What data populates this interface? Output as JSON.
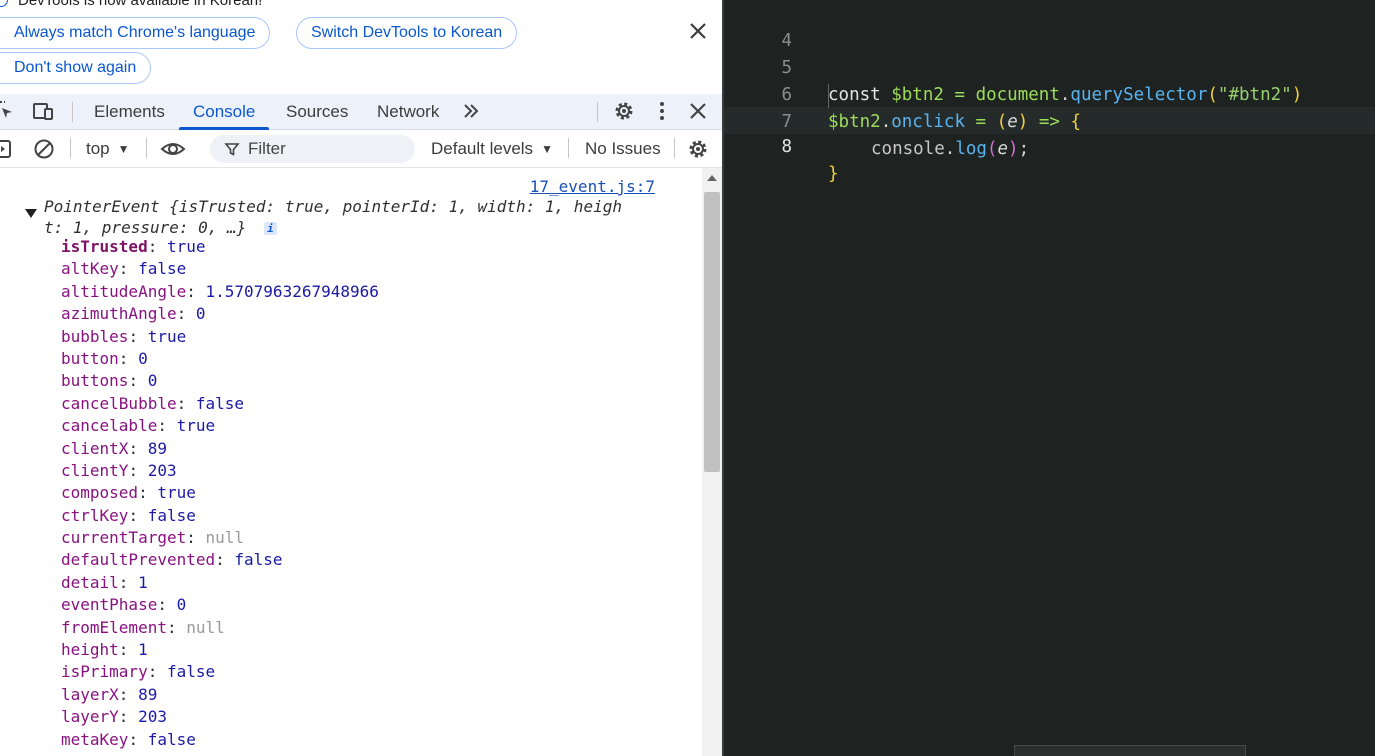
{
  "infobar": {
    "message": "DevTools is now available in Korean!",
    "btn_always_match": "Always match Chrome's language",
    "btn_switch": "Switch DevTools to Korean",
    "btn_dont_show": "Don't show again"
  },
  "tabs": [
    "Elements",
    "Console",
    "Sources",
    "Network"
  ],
  "active_tab": "Console",
  "consolebar": {
    "context": "top",
    "filter_placeholder": "Filter",
    "levels": "Default levels",
    "issues": "No Issues"
  },
  "console": {
    "source_link": "17_event.js:7",
    "summary_line1": "PointerEvent {isTrusted: true, pointerId: 1, width: 1, heigh",
    "summary_line2": "t: 1, pressure: 0, …}",
    "info_badge": "i",
    "properties": [
      {
        "key": "isTrusted",
        "value": "true",
        "kind": "bool"
      },
      {
        "key": "altKey",
        "value": "false",
        "kind": "bool"
      },
      {
        "key": "altitudeAngle",
        "value": "1.5707963267948966",
        "kind": "num"
      },
      {
        "key": "azimuthAngle",
        "value": "0",
        "kind": "num"
      },
      {
        "key": "bubbles",
        "value": "true",
        "kind": "bool"
      },
      {
        "key": "button",
        "value": "0",
        "kind": "num"
      },
      {
        "key": "buttons",
        "value": "0",
        "kind": "num"
      },
      {
        "key": "cancelBubble",
        "value": "false",
        "kind": "bool"
      },
      {
        "key": "cancelable",
        "value": "true",
        "kind": "bool"
      },
      {
        "key": "clientX",
        "value": "89",
        "kind": "num"
      },
      {
        "key": "clientY",
        "value": "203",
        "kind": "num"
      },
      {
        "key": "composed",
        "value": "true",
        "kind": "bool"
      },
      {
        "key": "ctrlKey",
        "value": "false",
        "kind": "bool"
      },
      {
        "key": "currentTarget",
        "value": "null",
        "kind": "null"
      },
      {
        "key": "defaultPrevented",
        "value": "false",
        "kind": "bool"
      },
      {
        "key": "detail",
        "value": "1",
        "kind": "num"
      },
      {
        "key": "eventPhase",
        "value": "0",
        "kind": "num"
      },
      {
        "key": "fromElement",
        "value": "null",
        "kind": "null"
      },
      {
        "key": "height",
        "value": "1",
        "kind": "num"
      },
      {
        "key": "isPrimary",
        "value": "false",
        "kind": "bool"
      },
      {
        "key": "layerX",
        "value": "89",
        "kind": "num"
      },
      {
        "key": "layerY",
        "value": "203",
        "kind": "num"
      },
      {
        "key": "metaKey",
        "value": "false",
        "kind": "bool"
      }
    ]
  },
  "editor": {
    "current_line": "8",
    "lines": [
      {
        "num": "4"
      },
      {
        "num": "5"
      },
      {
        "num": "6"
      },
      {
        "num": "7"
      },
      {
        "num": "8"
      }
    ],
    "tokens": {
      "const": "const",
      "btn_var": "$btn2",
      "eq": "=",
      "document": "document",
      "dot": ".",
      "qs": "querySelector",
      "lparen": "(",
      "selector": "\"#btn2\"",
      "rparen": ")",
      "onclick": "onclick",
      "param": "e",
      "arrow": "=>",
      "lbrace": "{",
      "console": "console",
      "log": "log",
      "semi": ";",
      "rbrace": "}"
    }
  },
  "colors": {
    "accent": "#0b57d0",
    "editor_bg": "#1e2322",
    "prop_key": "#881280"
  }
}
